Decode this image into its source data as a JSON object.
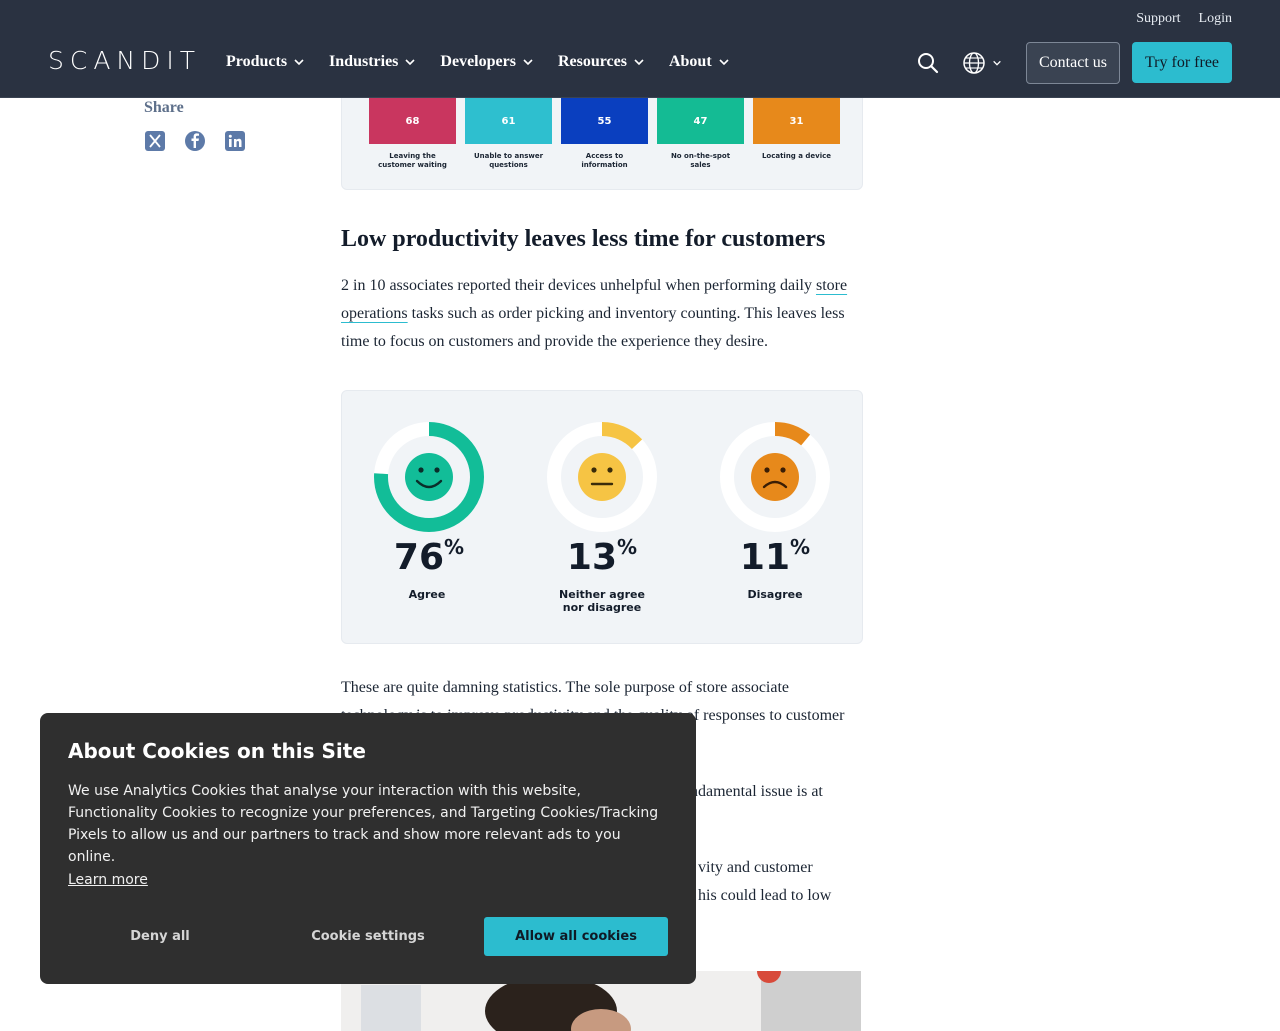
{
  "header": {
    "logo": "SCANDIT",
    "util_links": [
      "Support",
      "Login"
    ],
    "nav": [
      "Products",
      "Industries",
      "Developers",
      "Resources",
      "About"
    ],
    "contact_label": "Contact us",
    "try_label": "Try for free"
  },
  "share": {
    "label": "Share"
  },
  "bar_chart": {
    "bars": [
      {
        "value": "68",
        "caption": "Leaving the customer waiting",
        "color": "#c9365f"
      },
      {
        "value": "61",
        "caption": "Unable to answer questions",
        "color": "#2ebfcf"
      },
      {
        "value": "55",
        "caption": "Access to information",
        "color": "#0a3fbf"
      },
      {
        "value": "47",
        "caption": "No on-the-spot sales",
        "color": "#14bb94"
      },
      {
        "value": "31",
        "caption": "Locating a device",
        "color": "#e7891b"
      }
    ]
  },
  "article": {
    "heading": "Low productivity leaves less time for customers",
    "p1_pre": "2 in 10 associates reported their devices unhelpful when performing daily ",
    "p1_link": "store operations",
    "p1_post": " tasks such as order picking and inventory counting. This leaves less time to focus on customers and provide the experience they desire.",
    "p2_line1": "These are quite damning statistics. The sole purpose of store associate",
    "p2_line2": "technology is to improve productivity and the quality of responses to customer",
    "p3_tail": "ndamental issue is at",
    "p4_tail_1": "vity and customer",
    "p4_tail_2": "his could lead to low"
  },
  "donuts": [
    {
      "percent": "76",
      "label": "Agree",
      "color": "#12bd98",
      "fraction": 0.76
    },
    {
      "percent": "13",
      "label": "Neither agree nor disagree",
      "color": "#f6c444",
      "fraction": 0.13
    },
    {
      "percent": "11",
      "label": "Disagree",
      "color": "#e7891b",
      "fraction": 0.11
    }
  ],
  "cookie": {
    "title": "About Cookies on this Site",
    "body": "We use Analytics Cookies that analyse your interaction with this website, Functionality Cookies to recognize your preferences, and Targeting Cookies/Tracking Pixels to allow us and our partners to track and show more relevant ads to you online.",
    "learn_more": "Learn more",
    "deny": "Deny all",
    "settings": "Cookie settings",
    "allow": "Allow all cookies"
  }
}
